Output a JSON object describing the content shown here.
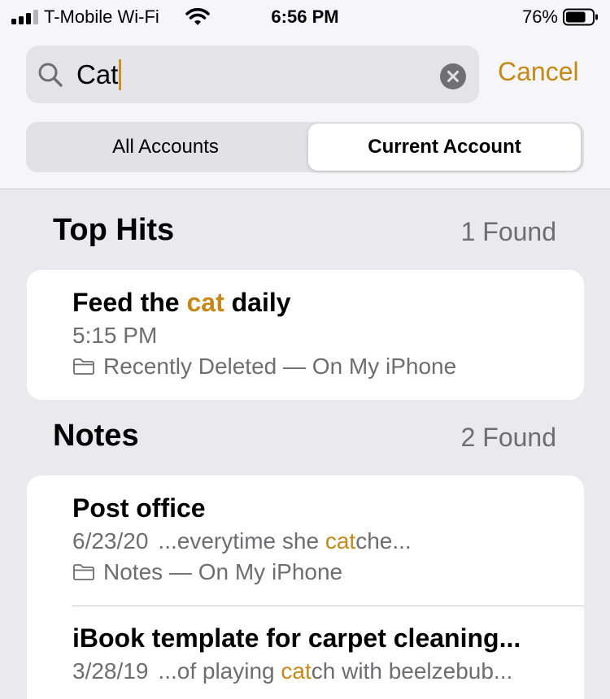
{
  "status_bar": {
    "carrier": "T-Mobile Wi-Fi",
    "time": "6:56 PM",
    "battery_percent": "76%",
    "battery_level": 0.76,
    "signal_bars": 3
  },
  "search": {
    "value": "Cat",
    "clear_icon": "xmark-circle-icon",
    "cancel_label": "Cancel"
  },
  "scope": {
    "all_label": "All Accounts",
    "current_label": "Current Account",
    "selected": "Current Account"
  },
  "top_hits": {
    "title": "Top Hits",
    "count": "1 Found",
    "items": [
      {
        "title_before": "Feed the ",
        "title_match": "cat",
        "title_after": " daily",
        "date": "5:15 PM",
        "location": "Recently Deleted — On My iPhone"
      }
    ]
  },
  "notes": {
    "title": "Notes",
    "count": "2 Found",
    "items": [
      {
        "title": "Post office",
        "date": "6/23/20",
        "snippet_before": "...everytime she ",
        "snippet_match": "cat",
        "snippet_after": "che...",
        "location": "Notes — On My iPhone"
      },
      {
        "title": "iBook template for carpet cleaning...",
        "date": "3/28/19",
        "snippet_before": "...of playing ",
        "snippet_match": "cat",
        "snippet_after": "ch with beelzebub..."
      }
    ]
  },
  "colors": {
    "accent": "#c68919",
    "background": "#e9e9ee",
    "secondary_text": "#6d6d72"
  }
}
